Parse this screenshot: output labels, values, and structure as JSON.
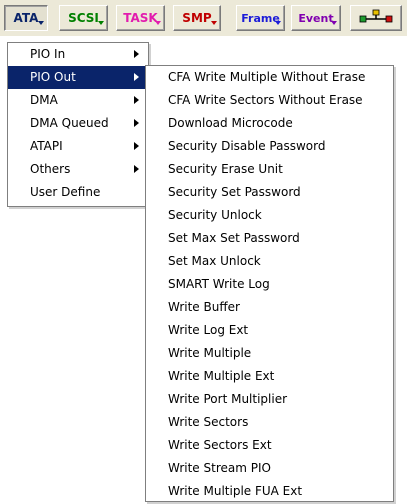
{
  "toolbar": {
    "buttons": [
      {
        "label": "ATA",
        "color": "#0a246a",
        "state": "pressed"
      },
      {
        "label": "SCSI",
        "color": "#008000"
      },
      {
        "label": "TASK",
        "color": "#e21cae"
      },
      {
        "label": "SMP",
        "color": "#c00000"
      },
      {
        "label": "Frame",
        "color": "#1c1cd8"
      },
      {
        "label": "Event",
        "color": "#8000b0"
      }
    ],
    "network_icon": "network-connect-icon"
  },
  "ata_menu": {
    "items": [
      {
        "label": "PIO In"
      },
      {
        "label": "PIO Out"
      },
      {
        "label": "DMA"
      },
      {
        "label": "DMA Queued"
      },
      {
        "label": "ATAPI"
      },
      {
        "label": "Others"
      },
      {
        "label": "User Define"
      }
    ],
    "selected": "PIO Out"
  },
  "pio_out_menu": {
    "items": [
      "CFA Write Multiple Without Erase",
      "CFA Write Sectors Without Erase",
      "Download Microcode",
      "Security Disable Password",
      "Security Erase Unit",
      "Security Set Password",
      "Security Unlock",
      "Set Max Set Password",
      "Set Max Unlock",
      "SMART Write Log",
      "Write Buffer",
      "Write Log Ext",
      "Write Multiple",
      "Write Multiple Ext",
      "Write Port Multiplier",
      "Write Sectors",
      "Write Sectors Ext",
      "Write Stream PIO",
      "Write Multiple FUA Ext"
    ]
  },
  "colors": {
    "selection_bg": "#0a246a",
    "selection_fg": "#ffffff",
    "toolbar_bg": "#ece9d8"
  }
}
